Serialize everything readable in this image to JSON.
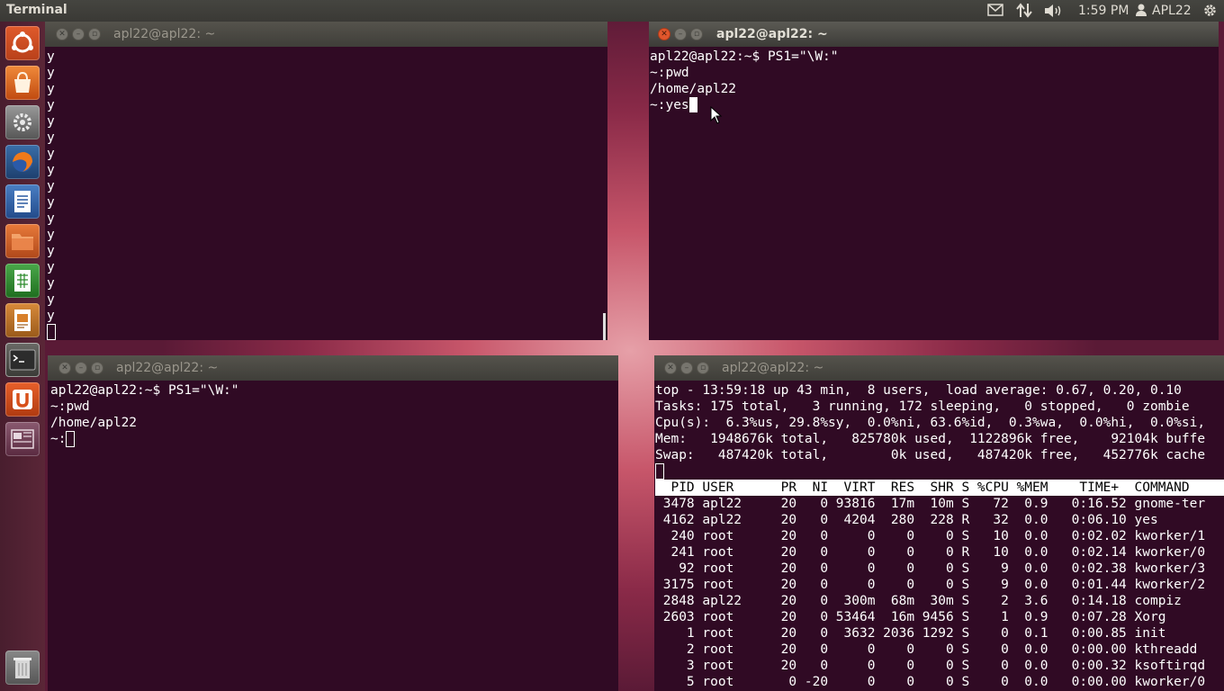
{
  "topbar": {
    "app_title": "Terminal",
    "time": "1:59 PM",
    "user": "APL22",
    "icons": [
      "mail-icon",
      "network-icon",
      "volume-icon",
      "user-icon",
      "gear-icon"
    ]
  },
  "launcher": {
    "items": [
      "ubuntu-dash-icon",
      "software-center-icon",
      "system-settings-icon",
      "firefox-icon",
      "libreoffice-writer-icon",
      "files-icon",
      "libreoffice-calc-icon",
      "libreoffice-impress-icon",
      "terminal-icon",
      "ubuntu-one-icon",
      "workspace-switcher-icon",
      "trash-icon"
    ]
  },
  "windows": {
    "w1": {
      "title": "apl22@apl22: ~",
      "lines": [
        "y",
        "y",
        "y",
        "y",
        "y",
        "y",
        "y",
        "y",
        "y",
        "y",
        "y",
        "y",
        "y",
        "y",
        "y",
        "y",
        "y"
      ]
    },
    "w2": {
      "title": "apl22@apl22: ~",
      "lines": [
        "apl22@apl22:~$ PS1=\"\\W:\"",
        "~:pwd",
        "/home/apl22",
        "~:yes"
      ]
    },
    "w3": {
      "title": "apl22@apl22: ~",
      "lines": [
        "apl22@apl22:~$ PS1=\"\\W:\"",
        "~:pwd",
        "/home/apl22",
        "~:"
      ]
    },
    "w4": {
      "title": "apl22@apl22: ~",
      "summary": [
        "top - 13:59:18 up 43 min,  8 users,  load average: 0.67, 0.20, 0.10",
        "Tasks: 175 total,   3 running, 172 sleeping,   0 stopped,   0 zombie",
        "Cpu(s):  6.3%us, 29.8%sy,  0.0%ni, 63.6%id,  0.3%wa,  0.0%hi,  0.0%si,",
        "Mem:   1948676k total,   825780k used,  1122896k free,    92104k buffe",
        "Swap:   487420k total,        0k used,   487420k free,   452776k cache"
      ],
      "header": "  PID USER      PR  NI  VIRT  RES  SHR S %CPU %MEM    TIME+  COMMAND",
      "rows": [
        " 3478 apl22     20   0 93816  17m  10m S   72  0.9   0:16.52 gnome-ter",
        " 4162 apl22     20   0  4204  280  228 R   32  0.0   0:06.10 yes",
        "  240 root      20   0     0    0    0 S   10  0.0   0:02.02 kworker/1",
        "  241 root      20   0     0    0    0 R   10  0.0   0:02.14 kworker/0",
        "   92 root      20   0     0    0    0 S    9  0.0   0:02.38 kworker/3",
        " 3175 root      20   0     0    0    0 S    9  0.0   0:01.44 kworker/2",
        " 2848 apl22     20   0  300m  68m  30m S    2  3.6   0:14.18 compiz",
        " 2603 root      20   0 53464  16m 9456 S    1  0.9   0:07.28 Xorg",
        "    1 root      20   0  3632 2036 1292 S    0  0.1   0:00.85 init",
        "    2 root      20   0     0    0    0 S    0  0.0   0:00.00 kthreadd",
        "    3 root      20   0     0    0    0 S    0  0.0   0:00.32 ksoftirqd",
        "    5 root       0 -20     0    0    0 S    0  0.0   0:00.00 kworker/0"
      ]
    }
  }
}
